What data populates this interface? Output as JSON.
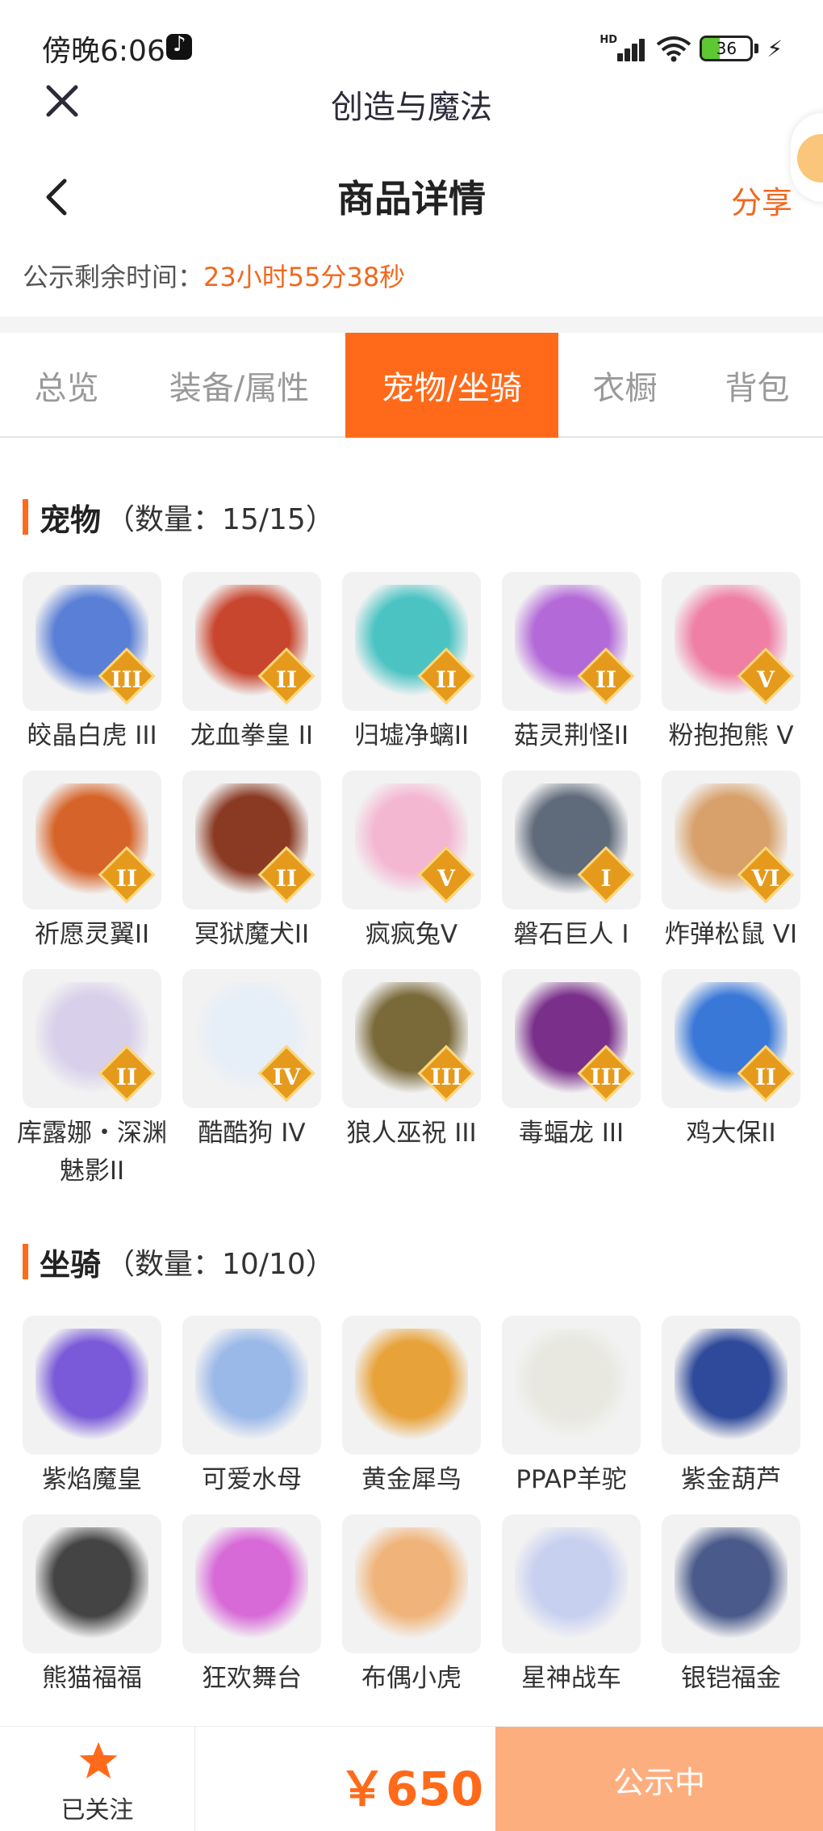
{
  "status_bar": {
    "time": "傍晚6:06",
    "network": "HD",
    "battery": "36"
  },
  "app": {
    "title": "创造与魔法"
  },
  "page": {
    "title": "商品详情",
    "share_label": "分享"
  },
  "countdown": {
    "label": "公示剩余时间：",
    "value": "23小时55分38秒"
  },
  "tabs": [
    {
      "label": "总览",
      "active": false
    },
    {
      "label": "装备/属性",
      "active": false
    },
    {
      "label": "宠物/坐骑",
      "active": true
    },
    {
      "label": "衣橱",
      "active": false
    },
    {
      "label": "背包",
      "active": false
    }
  ],
  "pets": {
    "title": "宠物",
    "count": "（数量：15/15）",
    "items": [
      {
        "name": "皎晶白虎 III",
        "rank": "III",
        "color": "#5a7fd6"
      },
      {
        "name": "龙血拳皇 II",
        "rank": "II",
        "color": "#c8452e"
      },
      {
        "name": "归墟净螭II",
        "rank": "II",
        "color": "#4cc3c3"
      },
      {
        "name": "菇灵荆怪II",
        "rank": "II",
        "color": "#b36ad8"
      },
      {
        "name": "粉抱抱熊 V",
        "rank": "V",
        "color": "#f07fa6"
      },
      {
        "name": "祈愿灵翼II",
        "rank": "II",
        "color": "#d6642a"
      },
      {
        "name": "冥狱魔犬II",
        "rank": "II",
        "color": "#8a3a22"
      },
      {
        "name": "疯疯兔V",
        "rank": "V",
        "color": "#f4b7d2"
      },
      {
        "name": "磐石巨人 I",
        "rank": "I",
        "color": "#5f6a7a"
      },
      {
        "name": "炸弹松鼠 VI",
        "rank": "VI",
        "color": "#d8a06a"
      },
      {
        "name": "库露娜・深渊魅影II",
        "rank": "II",
        "color": "#d8d0ea"
      },
      {
        "name": "酷酷狗 IV",
        "rank": "IV",
        "color": "#e6eef8"
      },
      {
        "name": "狼人巫祝 III",
        "rank": "III",
        "color": "#7a6a3a"
      },
      {
        "name": "毒蝠龙 III",
        "rank": "III",
        "color": "#7a2f8a"
      },
      {
        "name": "鸡大保II",
        "rank": "II",
        "color": "#3a78d8"
      }
    ]
  },
  "mounts": {
    "title": "坐骑",
    "count": "（数量：10/10）",
    "items": [
      {
        "name": "紫焰魔皇",
        "color": "#7a5ad8"
      },
      {
        "name": "可爱水母",
        "color": "#9ab8e8"
      },
      {
        "name": "黄金犀鸟",
        "color": "#e8a23a"
      },
      {
        "name": "PPAP羊驼",
        "color": "#e8e8e0"
      },
      {
        "name": "紫金葫芦",
        "color": "#2f4a9a"
      },
      {
        "name": "熊猫福福",
        "color": "#444444"
      },
      {
        "name": "狂欢舞台",
        "color": "#d86ad8"
      },
      {
        "name": "布偶小虎",
        "color": "#f0b47a"
      },
      {
        "name": "星神战车",
        "color": "#c8d0f0"
      },
      {
        "name": "银铠福金",
        "color": "#4a5a8a"
      }
    ]
  },
  "bottom_bar": {
    "follow_label": "已关注",
    "price": "￥650",
    "status_button": "公示中"
  }
}
